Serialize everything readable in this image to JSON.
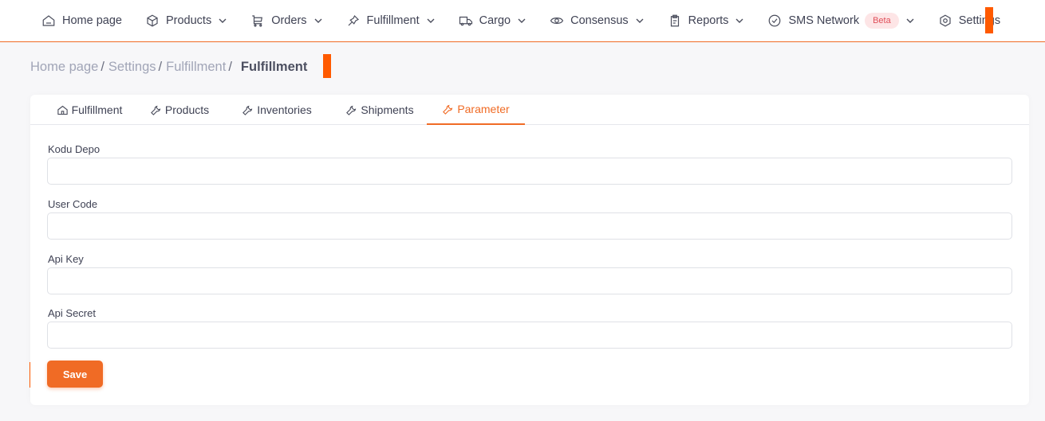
{
  "nav": {
    "items": [
      {
        "label": "Home page",
        "icon": "home-icon",
        "has_dropdown": false
      },
      {
        "label": "Products",
        "icon": "box-icon",
        "has_dropdown": true
      },
      {
        "label": "Orders",
        "icon": "cart-icon",
        "has_dropdown": true
      },
      {
        "label": "Fulfillment",
        "icon": "pin-icon",
        "has_dropdown": true
      },
      {
        "label": "Cargo",
        "icon": "truck-icon",
        "has_dropdown": true
      },
      {
        "label": "Consensus",
        "icon": "eye-icon",
        "has_dropdown": true
      },
      {
        "label": "Reports",
        "icon": "clipboard-icon",
        "has_dropdown": true
      },
      {
        "label": "SMS Network",
        "icon": "check-circle-icon",
        "has_dropdown": true,
        "badge": "Beta"
      },
      {
        "label": "Settings",
        "icon": "gear-icon",
        "has_dropdown": false
      }
    ]
  },
  "breadcrumb": {
    "items": [
      "Home page",
      "Settings",
      "Fulfillment"
    ],
    "separator": "/",
    "current": "Fulfillment"
  },
  "tabs": [
    {
      "label": "Fulfillment",
      "icon": "home-icon",
      "active": false
    },
    {
      "label": "Products",
      "icon": "wrench-icon",
      "active": false
    },
    {
      "label": "Inventories",
      "icon": "wrench-icon",
      "active": false
    },
    {
      "label": "Shipments",
      "icon": "wrench-icon",
      "active": false
    },
    {
      "label": "Parameter",
      "icon": "wrench-icon",
      "active": true
    }
  ],
  "form": {
    "fields": [
      {
        "label": "Kodu Depo",
        "value": "",
        "placeholder": ""
      },
      {
        "label": "User Code",
        "value": "",
        "placeholder": ""
      },
      {
        "label": "Api Key",
        "value": "",
        "placeholder": ""
      },
      {
        "label": "Api Secret",
        "value": "",
        "placeholder": ""
      }
    ],
    "save_label": "Save"
  },
  "colors": {
    "accent": "#f06b25",
    "marker": "#ff5a00",
    "beta_bg": "#fde5e6",
    "beta_text": "#e0505a"
  }
}
